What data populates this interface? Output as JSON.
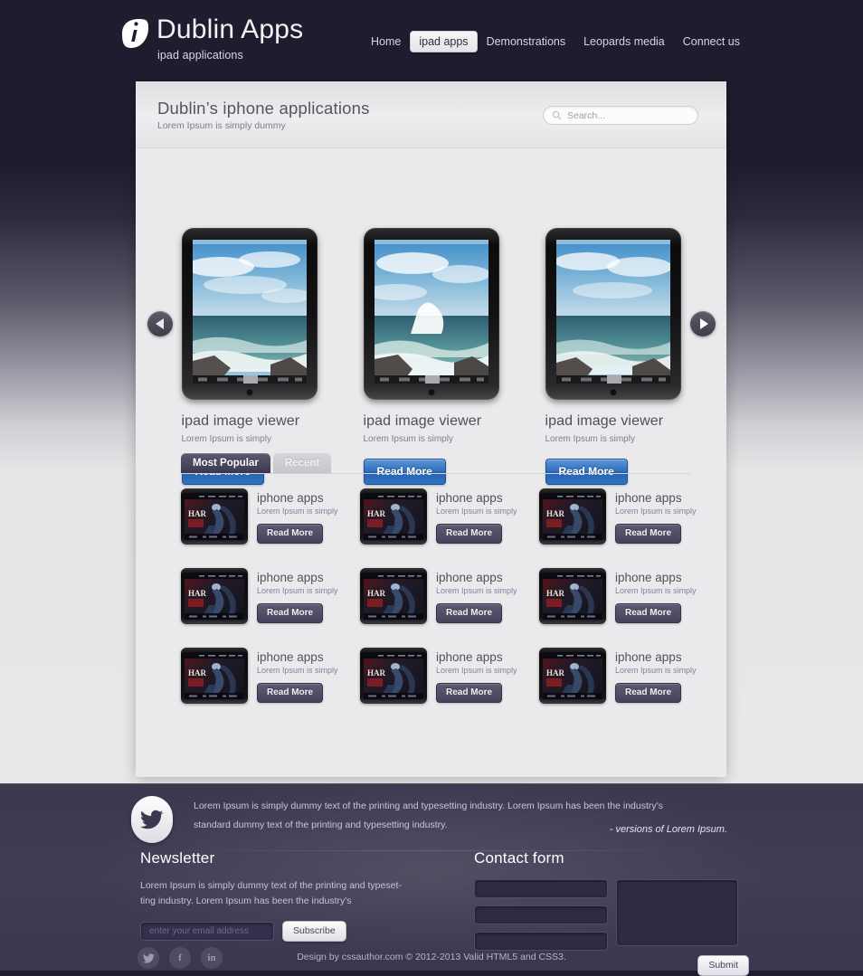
{
  "header": {
    "brand_title": "Dublin Apps",
    "brand_sub": "ipad applications",
    "logo_icon": "leaf-i-logo-icon",
    "nav": [
      {
        "label": "Home",
        "active": false
      },
      {
        "label": "ipad apps",
        "active": true
      },
      {
        "label": "Demonstrations",
        "active": false
      },
      {
        "label": "Leopards media",
        "active": false
      },
      {
        "label": "Connect us",
        "active": false
      }
    ]
  },
  "panel": {
    "title": "Dublin’s iphone applications",
    "subtitle": "Lorem Ipsum is simply dummy",
    "search_placeholder": "Search...",
    "search_value": "",
    "search_icon": "search-icon"
  },
  "carousel": {
    "prev_icon": "arrow-left-icon",
    "next_icon": "arrow-right-icon",
    "slides": [
      {
        "title": "ipad image viewer",
        "subtitle": "Lorem Ipsum is simply",
        "button": "Read More"
      },
      {
        "title": "ipad image viewer",
        "subtitle": "Lorem Ipsum is simply",
        "button": "Read More"
      },
      {
        "title": "ipad image viewer",
        "subtitle": "Lorem Ipsum is simply",
        "button": "Read More"
      }
    ]
  },
  "tabs": [
    {
      "label": "Most Popular",
      "active": true
    },
    {
      "label": "Recent",
      "active": false
    }
  ],
  "apps": [
    {
      "title": "iphone apps",
      "subtitle": "Lorem Ipsum is simply",
      "button": "Read More"
    },
    {
      "title": "iphone apps",
      "subtitle": "Lorem Ipsum is simply",
      "button": "Read More"
    },
    {
      "title": "iphone apps",
      "subtitle": "Lorem Ipsum is simply",
      "button": "Read More"
    },
    {
      "title": "iphone apps",
      "subtitle": "Lorem Ipsum is simply",
      "button": "Read More"
    },
    {
      "title": "iphone apps",
      "subtitle": "Lorem Ipsum is simply",
      "button": "Read More"
    },
    {
      "title": "iphone apps",
      "subtitle": "Lorem Ipsum is simply",
      "button": "Read More"
    },
    {
      "title": "iphone apps",
      "subtitle": "Lorem Ipsum is simply",
      "button": "Read More"
    },
    {
      "title": "iphone apps",
      "subtitle": "Lorem Ipsum is simply",
      "button": "Read More"
    },
    {
      "title": "iphone apps",
      "subtitle": "Lorem Ipsum is simply",
      "button": "Read More"
    }
  ],
  "footer": {
    "twitter_icon": "twitter-bird-icon",
    "blurb": "Lorem Ipsum is simply dummy text of the printing and typesetting industry. Lorem Ipsum has been the industry's standard dummy text  of the printing and typesetting industry.",
    "signature": "- versions of Lorem Ipsum.",
    "newsletter": {
      "heading": "Newsletter",
      "text": "Lorem Ipsum is simply dummy text of the printing and typeset-ting industry.  Lorem Ipsum has been the industry's",
      "email_placeholder": "enter your email address",
      "email_value": "",
      "subscribe_label": "Subscribe"
    },
    "contact": {
      "heading": "Contact form",
      "field1_value": "",
      "field2_value": "",
      "field3_value": "",
      "message_value": "",
      "submit_label": "Submit"
    },
    "social": [
      {
        "name": "twitter",
        "glyph": "❦"
      },
      {
        "name": "facebook",
        "glyph": "f"
      },
      {
        "name": "linkedin",
        "glyph": "in"
      }
    ],
    "copyright": "Design by cssauthor.com © 2012-2013  Valid HTML5 and CSS3."
  },
  "colors": {
    "page_dark": "#1e1c2e",
    "panel_bg": "#eaeaec",
    "accent_blue": "#2f6fbd",
    "footer_bg": "#3d3b52",
    "tab_active": "#4a4861"
  }
}
